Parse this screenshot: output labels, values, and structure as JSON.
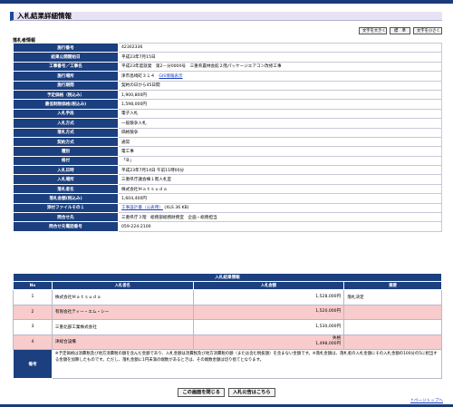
{
  "page": {
    "title": "入札結果詳細情報",
    "section_label": "落札者情報",
    "font_buttons": [
      "文字を大きく",
      "標　準",
      "文字を小さく"
    ]
  },
  "info_rows": [
    {
      "label": "施行番号",
      "value": "42302336"
    },
    {
      "label": "結果公開開始日",
      "value": "平成23年7月15日"
    },
    {
      "label": "工事番号／工事名",
      "value": "平成23年度就発　第2－分0000号　三重県農林会館２階パッケージエアコン改修工事"
    },
    {
      "label": "施行場所",
      "value": "津市島崎町３１４",
      "link": "GIS情報表示"
    },
    {
      "label": "施行期間",
      "value": "契約の日から45日間"
    },
    {
      "label": "予定価格（税込み）",
      "value": "1,900,800円"
    },
    {
      "label": "最低制限価格(税込み)",
      "value": "1,598,000円"
    },
    {
      "label": "入札手段",
      "value": "電子入札"
    },
    {
      "label": "入札方式",
      "value": "一般競争入札"
    },
    {
      "label": "落札方式",
      "value": "価格競争"
    },
    {
      "label": "契約方式",
      "value": "通常"
    },
    {
      "label": "種別",
      "value": "電工事"
    },
    {
      "label": "格付",
      "value": "「Ｂ」"
    },
    {
      "label": "入札日時",
      "value": "平成23年7月14日 午前11時00分"
    },
    {
      "label": "入札場所",
      "value": "三重県庁議会棟１階入札室"
    },
    {
      "label": "落札者名",
      "value": "株式会社Ｍａｔｓｕｄａ"
    },
    {
      "label": "落札金額(税込み)",
      "value": "1,604,400円"
    },
    {
      "label": "添付ファイルその１",
      "value": "(XLS 36 KB)",
      "link": "工事設計書（公表用）"
    },
    {
      "label": "問合せ先",
      "value": "三重県庁３階　総務部総務財務室　企画・総務担当"
    },
    {
      "label": "問合せ先電話番号",
      "value": "059-224-2100"
    }
  ],
  "results": {
    "title": "入札結果情報",
    "columns": [
      "No",
      "入札者名",
      "入札金額",
      "摘要"
    ],
    "rows": [
      {
        "no": "1",
        "name": "株式会社Ｍａｔｓｕｄａ",
        "amount": "1,528,000円",
        "amount_note": "",
        "remark": "落札決定",
        "highlight": false
      },
      {
        "no": "2",
        "name": "有限会社ティー・エム・シー",
        "amount": "1,520,000円",
        "amount_note": "",
        "remark": "",
        "highlight": true
      },
      {
        "no": "3",
        "name": "三重北部工業株式会社",
        "amount": "1,530,000円",
        "amount_note": "",
        "remark": "",
        "highlight": false
      },
      {
        "no": "4",
        "name": "津総合設備",
        "amount": "1,498,000円",
        "amount_note": "失格",
        "remark": "",
        "highlight": true
      }
    ],
    "biko_label": "備考",
    "biko_text": "※予定価格は消費税及び地方消費税の額を含んだ金額であり、入札金額は消費税及び地方消費税の額（または含む税抜額）を含まない金額です。※落札金額は、落札者の入札金額にその入札金額の100分の5に相当する金額を加算したものです。ただし、落札金額に1円未満の端数があるときは、その端数金額は切り捨てとなります。"
  },
  "actions": {
    "close_label": "この画面を閉じる",
    "notice_label": "入札公告はこちら"
  },
  "footer": {
    "page_top": "↑ページトップへ"
  },
  "colors": {
    "header_navy": "#1b3f7f",
    "highlight_pink": "#f8cccc",
    "title_bg": "#e8e2f4",
    "link": "#1a3fc0"
  }
}
